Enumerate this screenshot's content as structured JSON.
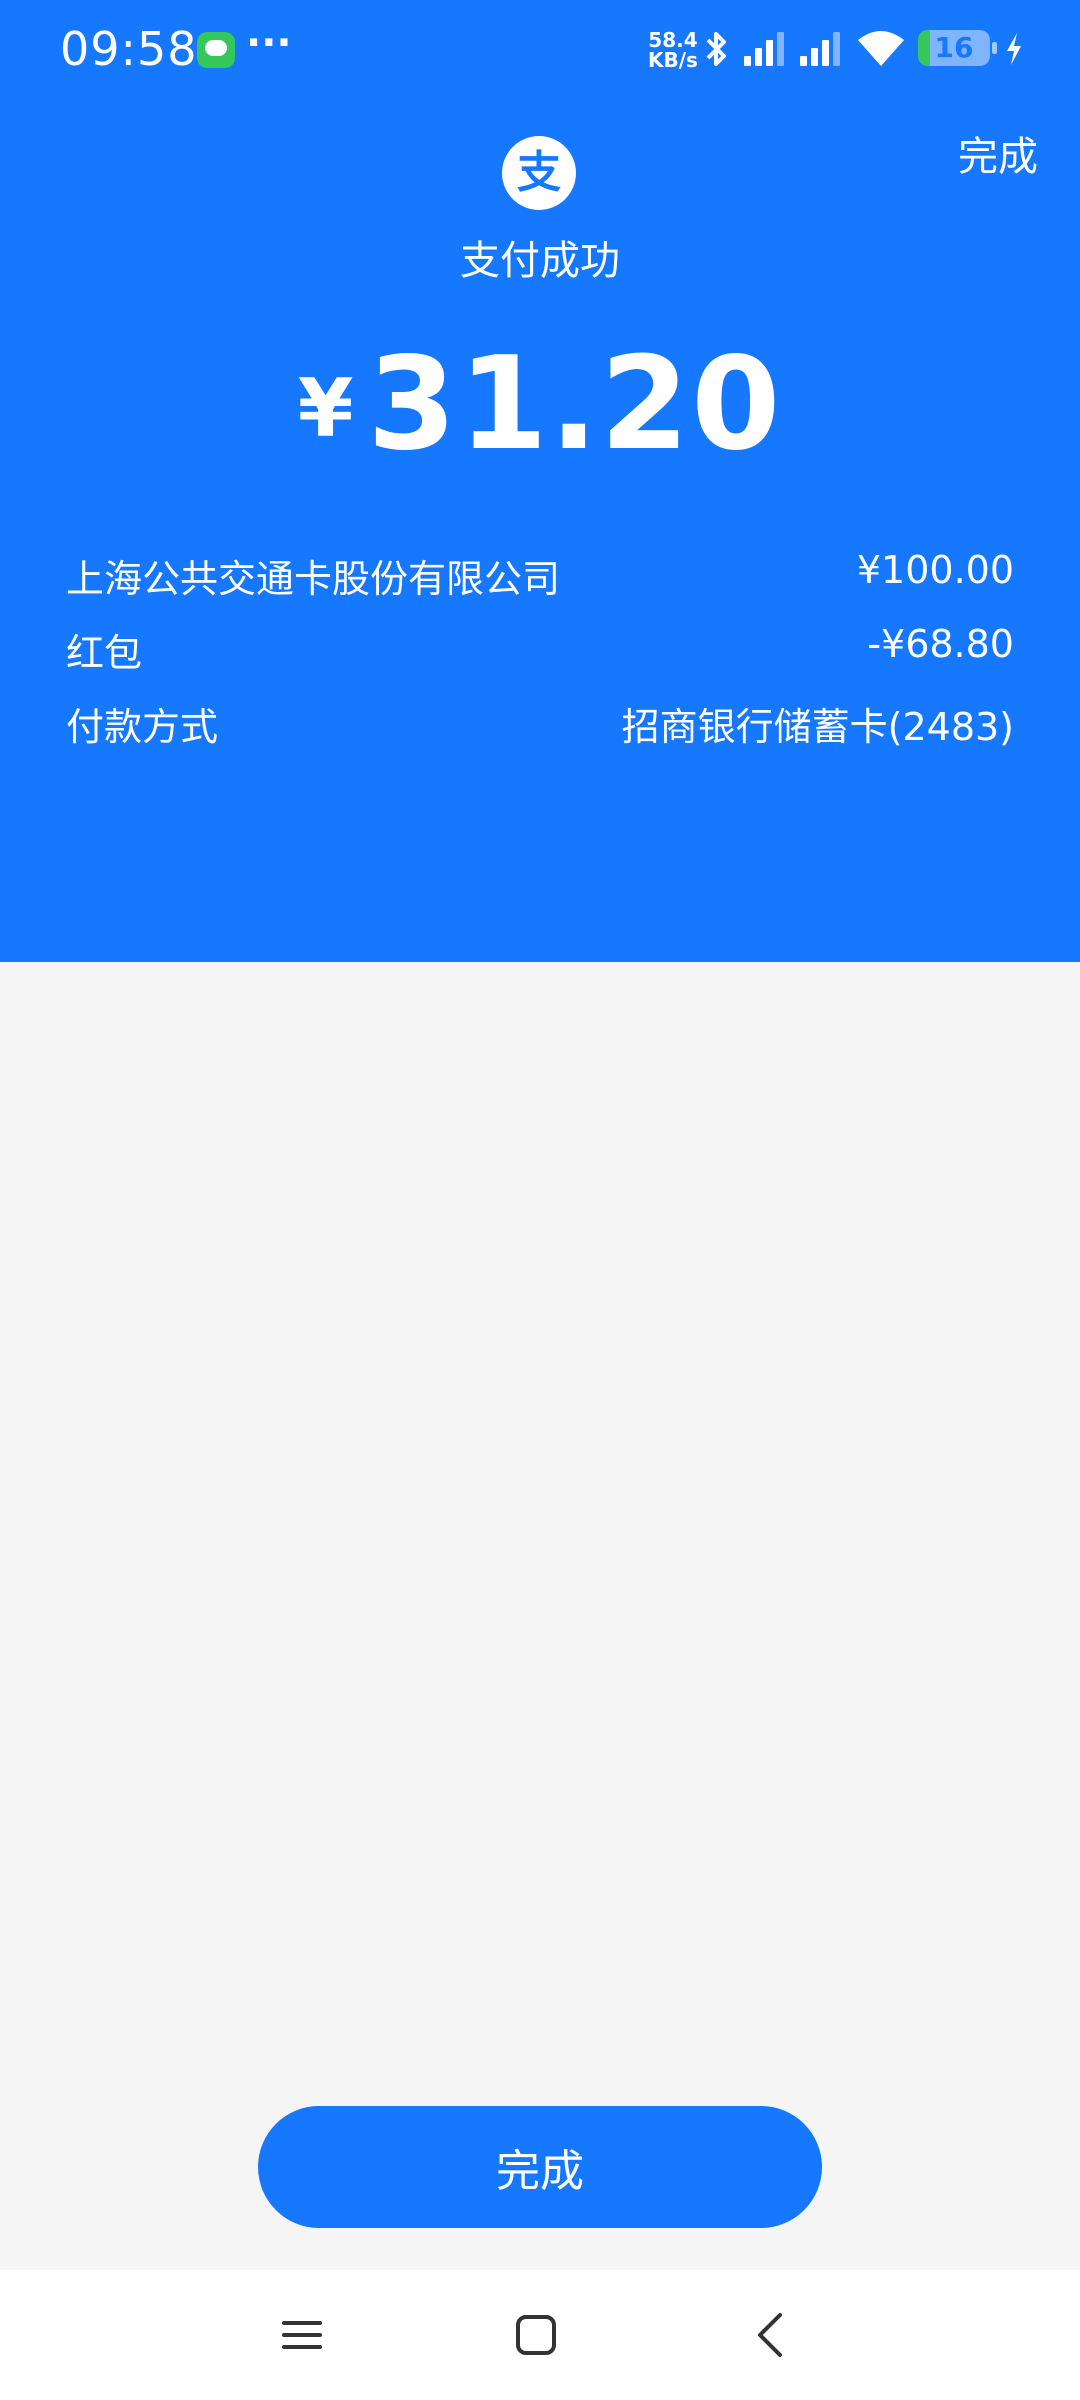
{
  "colors": {
    "primary": "#1677ff",
    "background": "#f5f5f5",
    "success_battery": "#34c759"
  },
  "status_bar": {
    "time": "09:58",
    "notification_icon": "message-icon",
    "more": "···",
    "net_speed_value": "58.4",
    "net_speed_unit": "KB/s",
    "battery_level": "16",
    "battery_fraction": 0.16
  },
  "header": {
    "done_label": "完成"
  },
  "result": {
    "logo_char": "支",
    "status": "支付成功",
    "currency_symbol": "¥",
    "amount": "31.20"
  },
  "details": [
    {
      "label": "上海公共交通卡股份有限公司",
      "value": "¥100.00"
    },
    {
      "label": "红包",
      "value": "-¥68.80"
    },
    {
      "label": "付款方式",
      "value": "招商银行储蓄卡(2483)"
    }
  ],
  "footer": {
    "done_button": "完成"
  },
  "nav_bar": {
    "icons": [
      "menu-icon",
      "home-icon",
      "back-icon"
    ]
  }
}
